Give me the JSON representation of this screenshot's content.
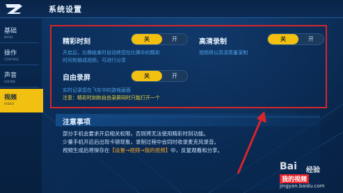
{
  "header": {
    "title": "系统设置"
  },
  "sidebar": {
    "items": [
      {
        "label": "基础",
        "sub": "BASIC"
      },
      {
        "label": "操作",
        "sub": "CONTROL"
      },
      {
        "label": "声音",
        "sub": "SOUND"
      },
      {
        "label": "视频",
        "sub": "VIDEO"
      }
    ],
    "active_index": 3
  },
  "settings": {
    "highlight": {
      "title": "精彩时刻",
      "toggle": {
        "on": "关",
        "off": "开",
        "selected": "on"
      },
      "desc_line1": "开启后，比赛结束时自动将您在比赛中的精彩",
      "desc_line2": "时间剪辑成视频，可进行分享"
    },
    "hd_record": {
      "title": "高清录制",
      "toggle": {
        "on": "关",
        "off": "开",
        "selected": "on"
      },
      "desc": "视频将以高清质量录制"
    },
    "free_record": {
      "title": "自由录屏",
      "toggle": {
        "on": "关",
        "off": "开",
        "selected": "on"
      },
      "desc": "实时记录您在飞车中的游戏画面",
      "note": "注意：精彩时刻和自由录屏同时只能打开一个"
    }
  },
  "notice": {
    "title": "注意事项",
    "line1": "部分手机会要求开启相关权限，否则将无法使用精彩时刻功能。",
    "line2": "少量手机开启后出现卡顿现象，录制过程中会同时收录麦克风录音。",
    "line3_pre": "视频生成后将保存在",
    "line3_hl": "【设置→视频→我的视频】",
    "line3_post": "中，反复观看和分享。"
  },
  "watermark": {
    "brand": "Bai",
    "brand2": "经验",
    "cn": "我的视频",
    "url": "jingyan.baidu.com"
  },
  "colors": {
    "accent": "#f2c010",
    "frame": "#d8252a",
    "desc": "#4fa3e6",
    "note": "#e8d23b"
  }
}
